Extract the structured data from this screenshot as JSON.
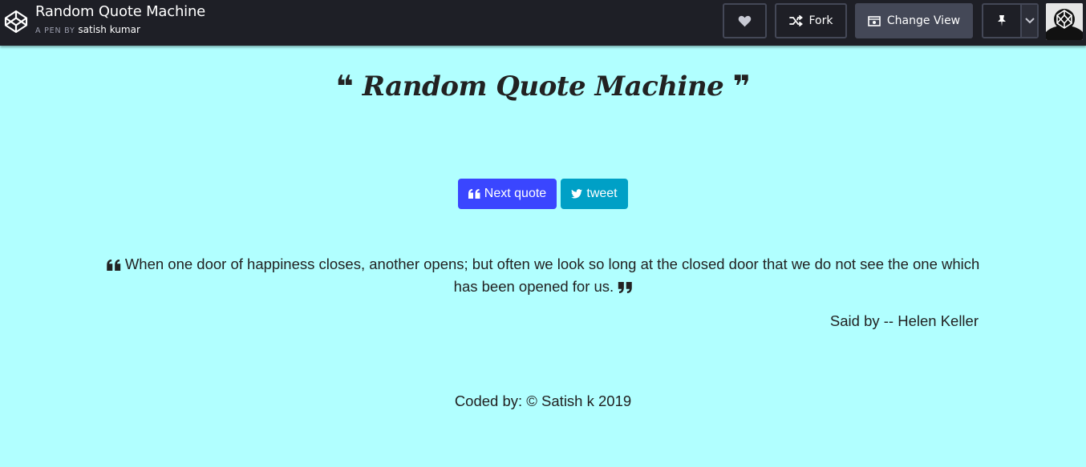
{
  "header": {
    "title": "Random Quote Machine",
    "pen_by": "A PEN BY",
    "author": "satish kumar",
    "fork_label": "Fork",
    "change_view_label": "Change View",
    "icons": [
      "codepen-logo-icon",
      "heart-icon",
      "fork-icon",
      "change-view-icon",
      "pin-icon",
      "chevron-down-icon",
      "avatar"
    ]
  },
  "page": {
    "heading": "Random Quote Machine",
    "next_quote_label": "Next quote",
    "tweet_label": "tweet",
    "quote_text": "When one door of happiness closes, another opens; but often we look so long at the closed door that we do not see the one which has been opened for us.",
    "author_line": "Said by -- Helen Keller",
    "footer": "Coded by: © Satish k 2019"
  },
  "colors": {
    "topbar": "#1e1f26",
    "background": "#b1ffff",
    "next_button": "#3a46ff",
    "tweet_button": "#00a0c6"
  }
}
